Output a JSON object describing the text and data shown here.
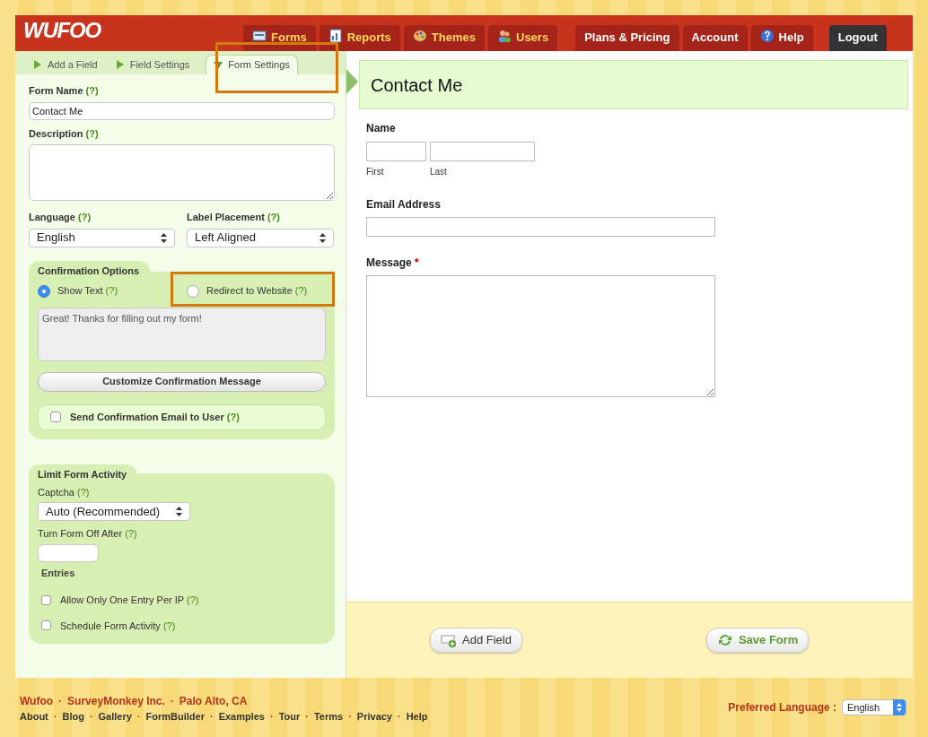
{
  "header": {
    "logo": "WUFOO",
    "nav": [
      {
        "label": "Forms",
        "kind": "main"
      },
      {
        "label": "Reports",
        "kind": "main"
      },
      {
        "label": "Themes",
        "kind": "main"
      },
      {
        "label": "Users",
        "kind": "main"
      },
      {
        "label": "Plans & Pricing",
        "kind": "account"
      },
      {
        "label": "Account",
        "kind": "account"
      },
      {
        "label": "Help",
        "kind": "account"
      },
      {
        "label": "Logout",
        "kind": "logout"
      }
    ]
  },
  "sidebar_tabs": [
    {
      "label": "Add a Field",
      "selected": false
    },
    {
      "label": "Field Settings",
      "selected": false
    },
    {
      "label": "Form Settings",
      "selected": true
    }
  ],
  "form_settings": {
    "form_name": {
      "label": "Form Name",
      "help": "(?)",
      "value": "Contact Me"
    },
    "description": {
      "label": "Description",
      "help": "(?)"
    },
    "language": {
      "label": "Language",
      "help": "(?)",
      "value": "English"
    },
    "label_placement": {
      "label": "Label Placement",
      "help": "(?)",
      "value": "Left Aligned"
    },
    "confirmation": {
      "title": "Confirmation Options",
      "options": [
        {
          "label": "Show Text",
          "help": "(?)",
          "selected": true
        },
        {
          "label": "Redirect to Website",
          "help": "(?)",
          "selected": false
        }
      ],
      "message": "Great! Thanks for filling out my form!",
      "button": "Customize Confirmation Message",
      "email": {
        "label": "Send Confirmation Email to User",
        "help": "(?)",
        "checked": false
      }
    },
    "limit": {
      "title": "Limit Form Activity",
      "captcha_label": "Captcha",
      "captcha_help": "(?)",
      "captcha_value": "Auto (Recommended)",
      "turn_off_label": "Turn Form Off After",
      "turn_off_help": "(?)",
      "entries_label": "Entries",
      "options": [
        {
          "label": "Allow Only One Entry Per IP",
          "help": "(?)",
          "checked": false
        },
        {
          "label": "Schedule Form Activity",
          "help": "(?)",
          "checked": false
        }
      ]
    }
  },
  "preview": {
    "title": "Contact Me",
    "fields": [
      {
        "kind": "name",
        "label": "Name",
        "sublabels": [
          "First",
          "Last"
        ]
      },
      {
        "kind": "email",
        "label": "Email Address"
      },
      {
        "kind": "textarea",
        "label": "Message",
        "required": "*"
      }
    ],
    "buttons": [
      {
        "label": "Add Field"
      },
      {
        "label": "Save Form"
      }
    ]
  },
  "footer": {
    "company_separators": [
      "·",
      "·"
    ],
    "link_separators": [
      "·",
      "·",
      "·",
      "·",
      "·",
      "·",
      "·",
      "·"
    ],
    "company": [
      "Wufoo",
      "SurveyMonkey Inc.",
      "Palo Alto, CA"
    ],
    "links": [
      "About",
      "Blog",
      "Gallery",
      "FormBuilder",
      "Examples",
      "Tour",
      "Terms",
      "Privacy",
      "Help"
    ],
    "language_label": "Preferred Language :",
    "language_value": "English"
  }
}
